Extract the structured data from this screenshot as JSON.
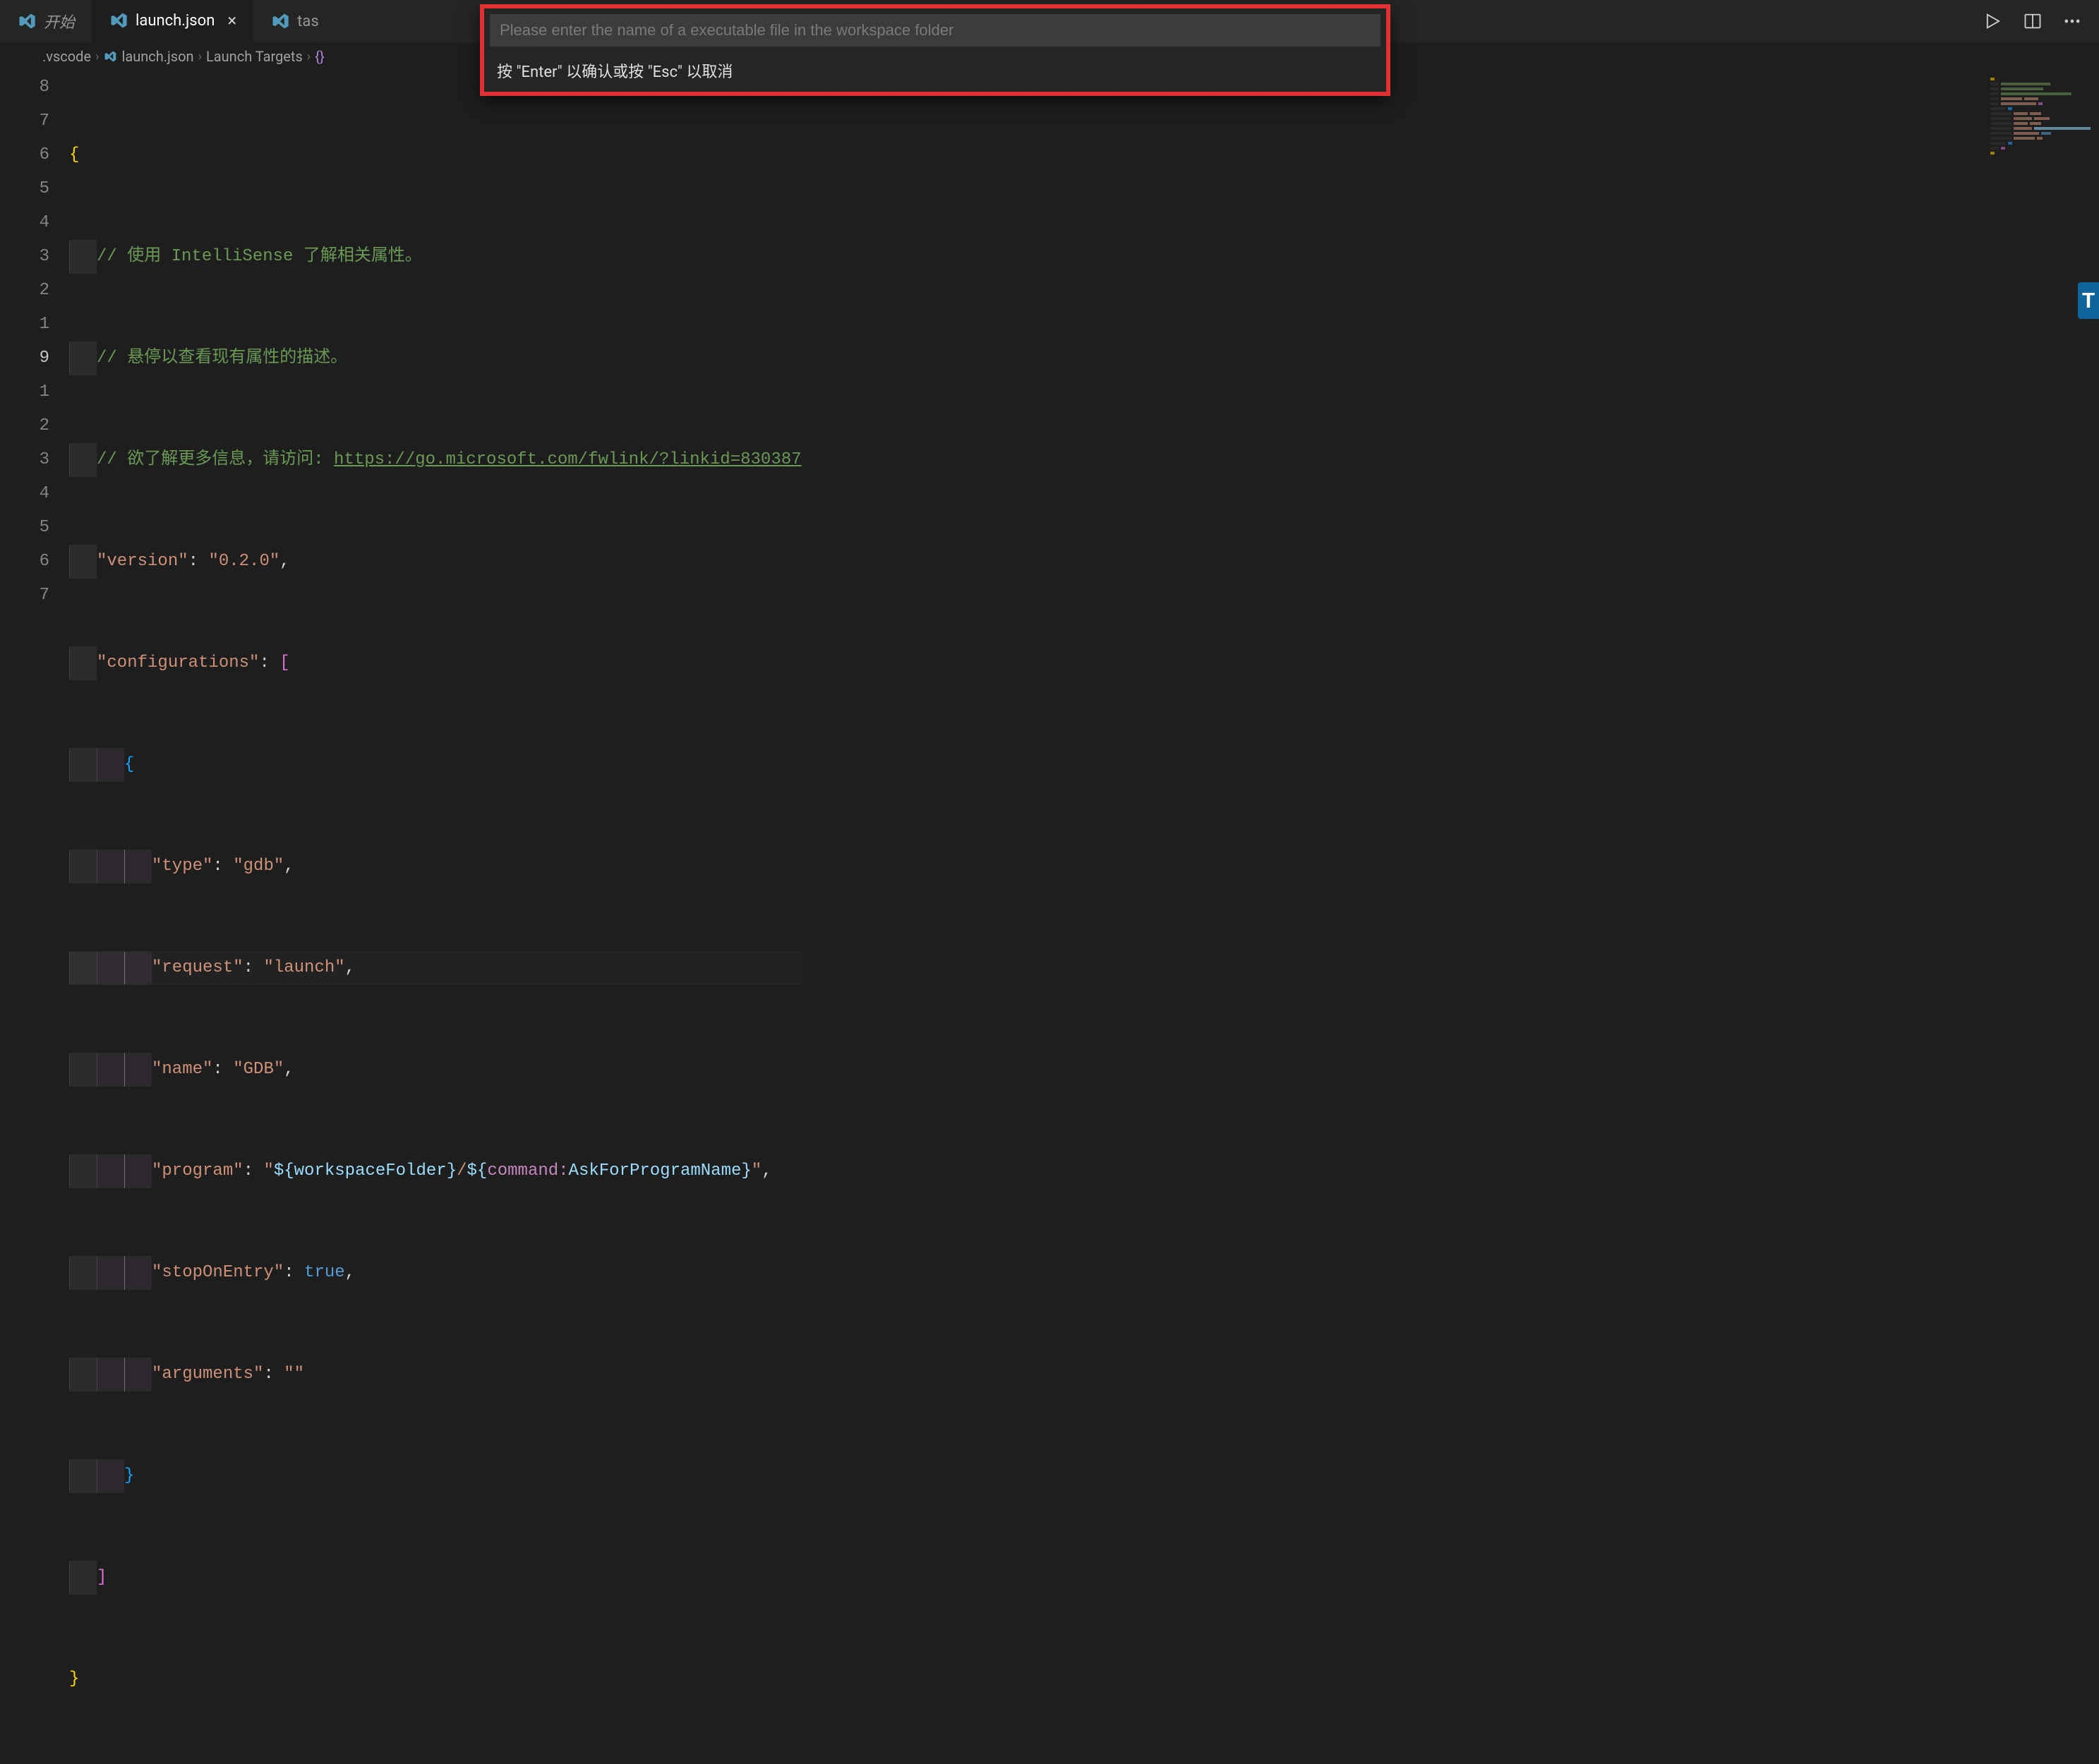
{
  "tabs": [
    {
      "label": "开始",
      "active": false,
      "italic": true
    },
    {
      "label": "launch.json",
      "active": true
    },
    {
      "label": "tas",
      "active": false
    }
  ],
  "breadcrumb": {
    "item0": ".vscode",
    "item1": "launch.json",
    "item2": "Launch Targets",
    "item3_icon": "{}"
  },
  "prompt": {
    "placeholder": "Please enter the name of a executable file in the workspace folder",
    "hint": "按 \"Enter\" 以确认或按 \"Esc\" 以取消"
  },
  "gutter": [
    "8",
    "7",
    "6",
    "5",
    "4",
    "3",
    "2",
    "1",
    "9",
    "1",
    "2",
    "3",
    "4",
    "5",
    "6",
    "7"
  ],
  "code": {
    "c1": "// 使用 IntelliSense 了解相关属性。",
    "c2": "// 悬停以查看现有属性的描述。",
    "c3_pre": "// 欲了解更多信息，请访问: ",
    "c3_url": "https://go.microsoft.com/fwlink/?linkid=830387",
    "k_version": "\"version\"",
    "v_version": "\"0.2.0\"",
    "k_configs": "\"configurations\"",
    "k_type": "\"type\"",
    "v_type": "\"gdb\"",
    "k_request": "\"request\"",
    "v_request": "\"launch\"",
    "k_name": "\"name\"",
    "v_name": "\"GDB\"",
    "k_program": "\"program\"",
    "v_program_q": "\"",
    "v_program_v1": "${",
    "v_program_v2": "workspaceFolder",
    "v_program_v3": "}",
    "v_program_sep": "/",
    "v_program_c1": "${",
    "v_program_c2": "command:",
    "v_program_c3": "AskForProgramName",
    "v_program_c4": "}",
    "k_stopOnEntry": "\"stopOnEntry\"",
    "v_true": "true",
    "k_arguments": "\"arguments\"",
    "v_empty": "\"\""
  },
  "help": "T"
}
